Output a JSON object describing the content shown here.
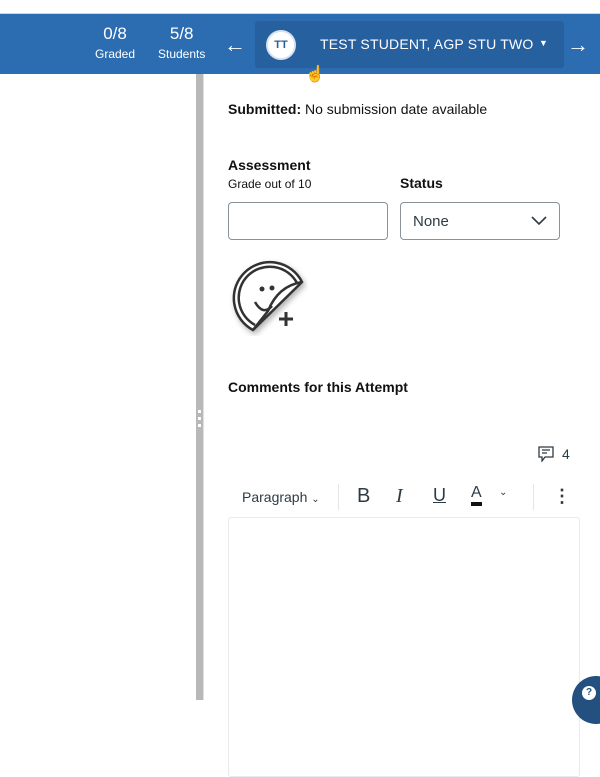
{
  "header": {
    "graded": {
      "value": "0/8",
      "label": "Graded"
    },
    "students": {
      "value": "5/8",
      "label": "Students"
    },
    "prev_icon": "arrow-left-icon",
    "next_icon": "arrow-right-icon",
    "student": {
      "initials": "TT",
      "name": "TEST STUDENT, AGP STU TWO"
    }
  },
  "submission": {
    "label": "Submitted:",
    "value": "No submission date available"
  },
  "assessment": {
    "title": "Assessment",
    "grade_label": "Grade out of 10",
    "grade_value": "",
    "status_label": "Status",
    "status_value": "None"
  },
  "comments": {
    "title": "Comments for this Attempt",
    "count": "4",
    "toolbar": {
      "paragraph": "Paragraph",
      "bold": "B",
      "italic": "I",
      "underline": "U",
      "color": "A"
    }
  },
  "colors": {
    "header": "#2c6db2",
    "selector": "#27609f"
  }
}
